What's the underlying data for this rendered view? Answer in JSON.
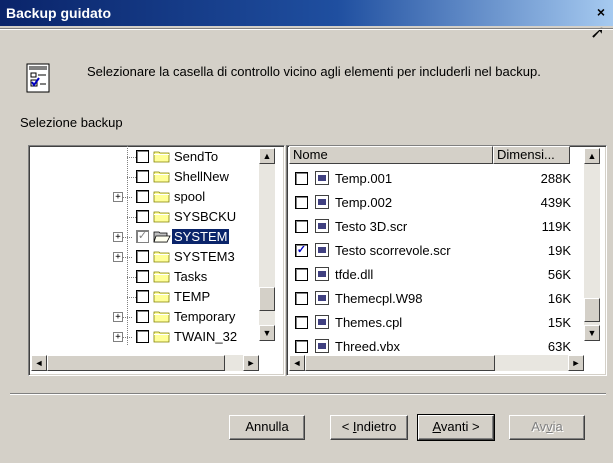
{
  "window": {
    "title": "Backup guidato",
    "close_glyph": "×"
  },
  "intro": {
    "icon": "checklist-icon",
    "text": "Selezionare la casella di controllo vicino agli elementi per includerli nel backup."
  },
  "selection_label": "Selezione backup",
  "tree": {
    "items": [
      {
        "label": "SendTo",
        "expander": "",
        "check": ""
      },
      {
        "label": "ShellNew",
        "expander": "",
        "check": ""
      },
      {
        "label": "spool",
        "expander": "+",
        "check": ""
      },
      {
        "label": "SYSBCKU",
        "expander": "",
        "check": ""
      },
      {
        "label": "SYSTEM",
        "expander": "+",
        "check": "✓",
        "selected": true,
        "grey": true
      },
      {
        "label": "SYSTEM3",
        "expander": "+",
        "check": ""
      },
      {
        "label": "Tasks",
        "expander": "",
        "check": ""
      },
      {
        "label": "TEMP",
        "expander": "",
        "check": ""
      },
      {
        "label": "Temporary",
        "expander": "+",
        "check": ""
      },
      {
        "label": "TWAIN_32",
        "expander": "+",
        "check": ""
      }
    ]
  },
  "files": {
    "columns": {
      "name": "Nome",
      "size": "Dimensi..."
    },
    "rows": [
      {
        "name": "Temp.001",
        "size": "288K",
        "check": ""
      },
      {
        "name": "Temp.002",
        "size": "439K",
        "check": ""
      },
      {
        "name": "Testo 3D.scr",
        "size": "119K",
        "check": ""
      },
      {
        "name": "Testo scorrevole.scr",
        "size": "19K",
        "check": "✓"
      },
      {
        "name": "tfde.dll",
        "size": "56K",
        "check": ""
      },
      {
        "name": "Themecpl.W98",
        "size": "16K",
        "check": ""
      },
      {
        "name": "Themes.cpl",
        "size": "15K",
        "check": ""
      },
      {
        "name": "Threed.vbx",
        "size": "63K",
        "check": ""
      }
    ]
  },
  "scroll": {
    "up": "▲",
    "down": "▼",
    "left": "◄",
    "right": "►"
  },
  "buttons": {
    "cancel": "Annulla",
    "back_prefix": "< ",
    "back_ul": "I",
    "back_rest": "ndietro",
    "next_ul": "A",
    "next_rest": "vanti >",
    "start_prefix": "Av",
    "start_ul": "v",
    "start_rest": "ia"
  },
  "colors": {
    "title_bar": "#0a246a",
    "selection": "#0a246a",
    "face": "#d4d0c8"
  }
}
